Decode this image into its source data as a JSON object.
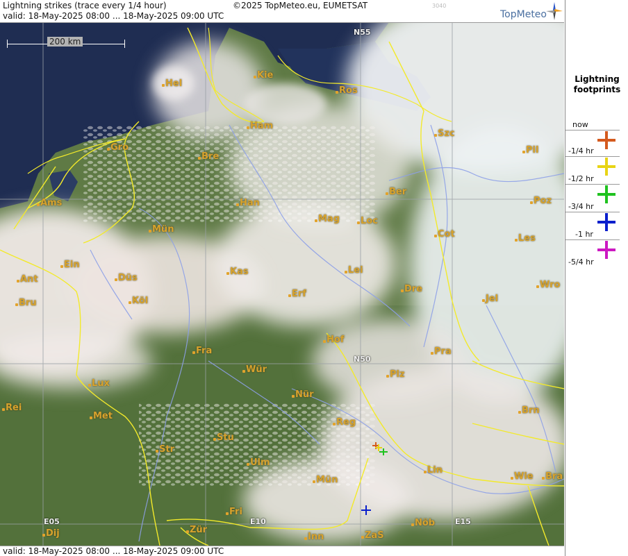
{
  "header": {
    "title": "Lightning strikes (trace every 1/4 hour)",
    "copyright": "©2025 TopMeteo.eu, EUMETSAT",
    "valid": "valid:  18-May-2025 08:00 ... 18-May-2025 09:00 UTC",
    "small_code": "3040",
    "brand": "TopMeteo"
  },
  "footer": {
    "valid": "valid:  18-May-2025 08:00 ... 18-May-2025 09:00 UTC"
  },
  "scale": {
    "label": "200 km"
  },
  "legend": {
    "title_line1": "Lightning",
    "title_line2": "footprints",
    "items": [
      {
        "label": "now",
        "color": "#d45a1e"
      },
      {
        "label": "-1/4 hr",
        "color": "#e8d415"
      },
      {
        "label": "-1/2 hr",
        "color": "#1fc21f"
      },
      {
        "label": "-3/4 hr",
        "color": "#0a1fcc"
      },
      {
        "label": "-1 hr",
        "color": "#cc19c2"
      },
      {
        "label": "-5/4 hr",
        "color": ""
      }
    ]
  },
  "cities": [
    "Hel",
    "Kie",
    "Ros",
    "Ham",
    "Szc",
    "Gro",
    "Bre",
    "Pil",
    "Ber",
    "Ams",
    "Han",
    "Poz",
    "Mag",
    "Loc",
    "Mün",
    "Cot",
    "Les",
    "Ein",
    "Kas",
    "Lei",
    "Ant",
    "Düs",
    "Wro",
    "Köl",
    "Bru",
    "Erf",
    "Dre",
    "Jel",
    "Hof",
    "Fra",
    "Pra",
    "Wür",
    "Plz",
    "Lux",
    "Rei",
    "Nür",
    "Met",
    "Brn",
    "Reg",
    "Stu",
    "Str",
    "Ulm",
    "Lin",
    "Mün",
    "Wie",
    "Bra",
    "Fri",
    "Dij",
    "Zür",
    "Inn",
    "ZaS",
    "Nöb"
  ],
  "coords": [
    "N55",
    "N50",
    "E05",
    "E10",
    "E15"
  ],
  "colors": {
    "border": "#f3ea2a",
    "river": "#8da0e8",
    "grid": "#9aa0a6",
    "city": "#d7a22d"
  }
}
